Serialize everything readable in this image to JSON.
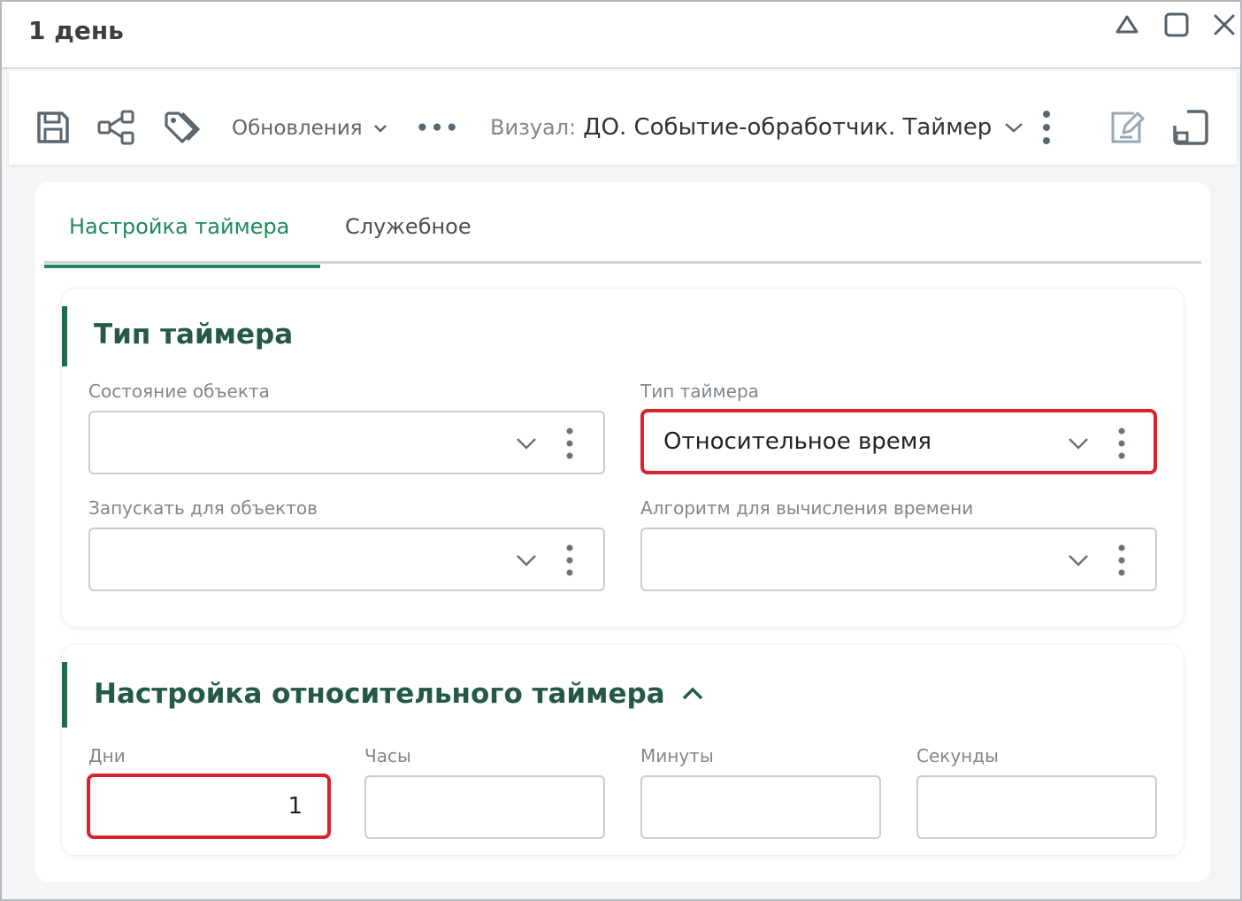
{
  "window": {
    "title": "1 день",
    "controls": [
      "home-icon",
      "maximize-icon",
      "close-icon"
    ]
  },
  "toolbar": {
    "icons": [
      "save-icon",
      "share-icon",
      "tags-icon"
    ],
    "updates_label": "Обновления",
    "more_label": "•••",
    "visual_label": "Визуал:",
    "visual_value": "ДО. Событие-обработчик. Таймер",
    "right_icons": [
      "edit-icon",
      "layout-icon"
    ]
  },
  "tabs": [
    {
      "label": "Настройка таймера",
      "active": true
    },
    {
      "label": "Служебное",
      "active": false
    }
  ],
  "timer_type_section": {
    "title": "Тип таймера",
    "fields": [
      {
        "label": "Состояние объекта",
        "value": ""
      },
      {
        "label": "Тип таймера",
        "value": "Относительное время",
        "highlighted": true
      },
      {
        "label": "Запускать для объектов",
        "value": ""
      },
      {
        "label": "Алгоритм для вычисления времени",
        "value": ""
      }
    ]
  },
  "relative_timer_section": {
    "title": "Настройка относительного таймера",
    "collapse_icon": "chevron-up-icon",
    "fields": [
      {
        "label": "Дни",
        "value": "1",
        "highlighted": true
      },
      {
        "label": "Часы",
        "value": ""
      },
      {
        "label": "Минуты",
        "value": ""
      },
      {
        "label": "Секунды",
        "value": ""
      }
    ]
  },
  "colors": {
    "accent_green": "#1e8a5a",
    "section_title": "#245a45",
    "highlight_red": "#d8232f"
  }
}
